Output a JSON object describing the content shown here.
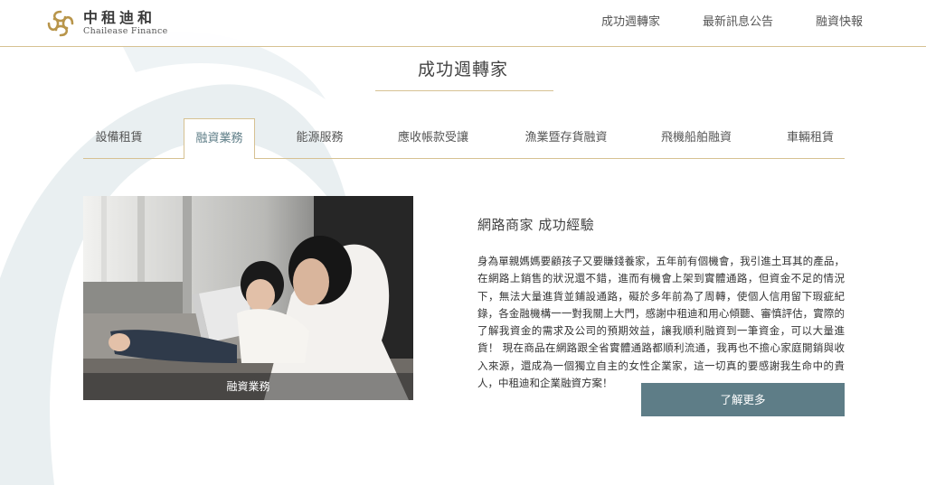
{
  "header": {
    "logo_cn": "中租迪和",
    "logo_en": "Chailease Finance",
    "nav": [
      "成功週轉家",
      "最新訊息公告",
      "融資快報"
    ]
  },
  "page": {
    "title": "成功週轉家"
  },
  "tabs": [
    "設備租賃",
    "融資業務",
    "能源服務",
    "應收帳款受讓",
    "漁業暨存貨融資",
    "飛機船舶融資",
    "車輛租賃"
  ],
  "active_tab": "融資業務",
  "story": {
    "image_caption": "融資業務",
    "title": "網路商家 成功經驗",
    "body": "身為單親媽媽要顧孩子又要賺錢養家，五年前有個機會，我引進土耳其的產品，在網路上銷售的狀況還不錯，進而有機會上架到實體通路，但資金不足的情況下，無法大量進貨並鋪設通路，礙於多年前為了周轉，使個人信用留下瑕疵紀錄，各金融機構一一對我關上大門，感謝中租迪和用心傾聽、審慎評估，實際的了解我資金的需求及公司的預期效益，讓我順利融資到一筆資金，可以大量進貨！ 現在商品在網路跟全省實體通路都順利流通，我再也不擔心家庭開銷與收入來源，還成為一個獨立自主的女性企業家，這一切真的要感謝我生命中的貴人，中租迪和企業融資方案！",
    "more_button": "了解更多"
  },
  "colors": {
    "accent": "#5e7d87",
    "gold": "#d6c192",
    "logo_gold": "#b8954a"
  }
}
